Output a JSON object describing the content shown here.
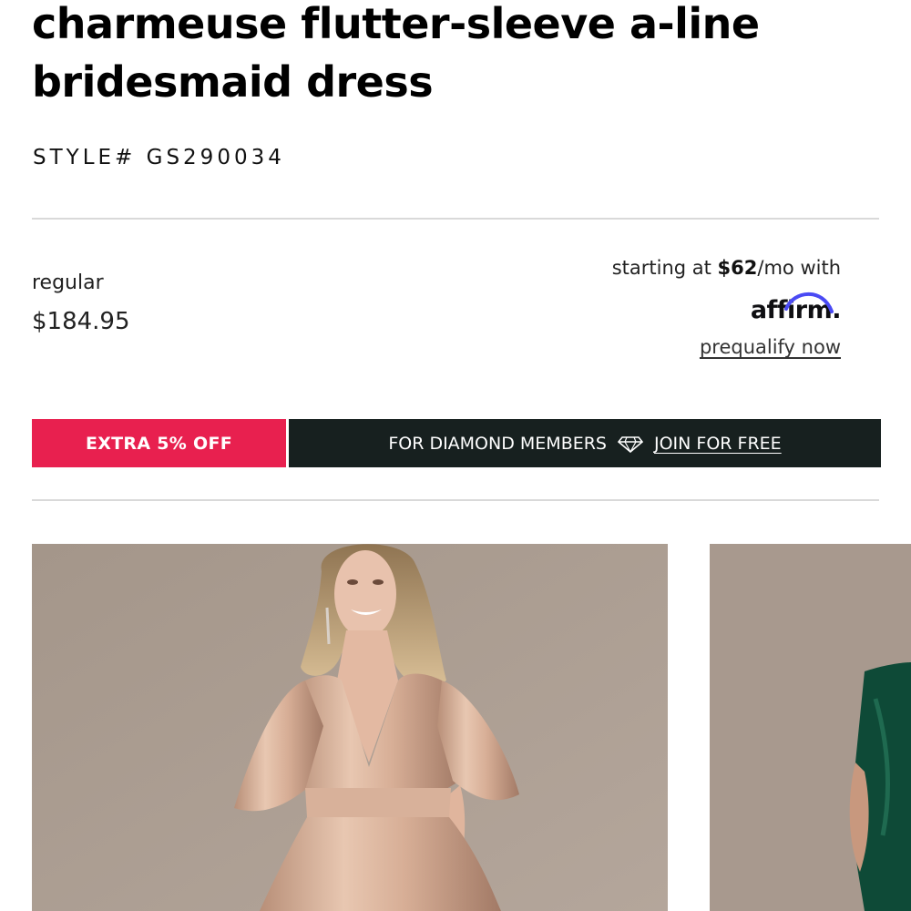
{
  "product": {
    "title": "charmeuse flutter-sleeve a-line bridesmaid dress",
    "style_number": "STYLE# GS290034"
  },
  "pricing": {
    "label": "regular",
    "price": "$184.95"
  },
  "financing": {
    "prefix": "starting at ",
    "amount": "$62",
    "suffix": "/mo with",
    "provider": "affirm",
    "provider_dot": ".",
    "link": "prequalify now"
  },
  "promo": {
    "discount": "EXTRA 5% OFF",
    "members_text": "FOR DIAMOND MEMBERS",
    "icon": "diamond-icon",
    "cta": "JOIN FOR FREE"
  },
  "gallery": {
    "images": [
      {
        "name": "model-champagne-dress-photo"
      },
      {
        "name": "model-green-dress-photo"
      }
    ]
  },
  "colors": {
    "promo_pink": "#e8204f",
    "promo_dark": "#17201f",
    "affirm_arc": "#4a4af4",
    "photo_backdrop": "#ab9c91"
  }
}
